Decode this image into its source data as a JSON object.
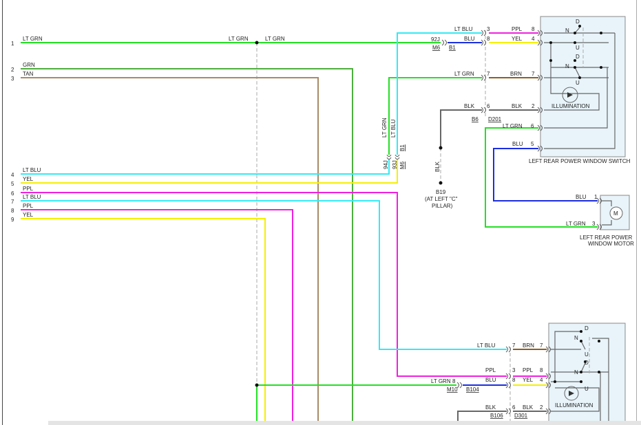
{
  "colors": {
    "lt_grn": "#22e022",
    "grn": "#4caf3c",
    "tan": "#a88a64",
    "lt_blu": "#33eaf5",
    "yel": "#f5f000",
    "ppl": "#f020e0",
    "blu": "#1a2ee0",
    "brn": "#8a6020",
    "blk": "#666666",
    "box_fill": "#e8f4fa"
  },
  "left_pins": [
    {
      "num": "1",
      "color": "LT GRN"
    },
    {
      "num": "2",
      "color": "GRN"
    },
    {
      "num": "3",
      "color": "TAN"
    },
    {
      "num": "4",
      "color": "LT BLU"
    },
    {
      "num": "5",
      "color": "YEL"
    },
    {
      "num": "6",
      "color": "PPL"
    },
    {
      "num": "7",
      "color": "LT BLU"
    },
    {
      "num": "8",
      "color": "PPL"
    },
    {
      "num": "9",
      "color": "YEL"
    }
  ],
  "splice_labels": {
    "a": "LT GRN",
    "b": "LT GRN"
  },
  "vertical_conn": {
    "w1": "LT GRN",
    "w2": "LT BLU",
    "c1": "94J",
    "c2": "93J",
    "c3": "M6",
    "c4": "B1"
  },
  "top_conn": {
    "c92j": "92J",
    "m6": "M6",
    "b1": "B1",
    "b6": "B6",
    "d201": "D201",
    "rows": [
      {
        "lcolor": "LT BLU",
        "lpin": "3",
        "rcolor": "PPL",
        "rpin": "8"
      },
      {
        "lcolor": "BLU",
        "lpin": "8",
        "rcolor": "YEL",
        "rpin": "4"
      },
      {
        "lcolor": "LT GRN",
        "lpin": "7",
        "rcolor": "BRN",
        "rpin": "7"
      },
      {
        "lcolor": "BLK",
        "lpin": "6",
        "rcolor": "BLK",
        "rpin": "2"
      }
    ],
    "ltgrn6": "LT GRN",
    "pin6": "6",
    "blu5": "BLU",
    "pin5": "5"
  },
  "ground": {
    "wire": "BLK",
    "id": "B19",
    "loc1": "(AT LEFT \"C\"",
    "loc2": "PILLAR)"
  },
  "switch1": {
    "title": "LEFT REAR POWER WINDOW SWITCH",
    "illum": "ILLUMINATION",
    "d": "D",
    "n": "N",
    "u": "U"
  },
  "motor": {
    "title1": "LEFT REAR POWER",
    "title2": "WINDOW MOTOR",
    "m": "M",
    "blu": "BLU",
    "pin1": "1",
    "ltgrn": "LT GRN",
    "pin3": "3"
  },
  "bottom_conn": {
    "m10": "M10",
    "b104": "B104",
    "b106": "B106",
    "d301": "D301",
    "ltgrn": "LT GRN",
    "pin8": "8",
    "rows": [
      {
        "lcolor": "LT BLU",
        "lpin": "7",
        "rcolor": "BRN",
        "rpin": "7"
      },
      {
        "lcolor": "PPL",
        "lpin": "3",
        "rcolor": "PPL",
        "rpin": "8"
      },
      {
        "lcolor": "BLU",
        "lpin": "8",
        "rcolor": "YEL",
        "rpin": "4"
      },
      {
        "lcolor": "BLK",
        "lpin": "6",
        "rcolor": "BLK",
        "rpin": "2"
      }
    ]
  },
  "switch2": {
    "illum": "ILLUMINATION",
    "d": "D",
    "n": "N",
    "u": "U"
  }
}
